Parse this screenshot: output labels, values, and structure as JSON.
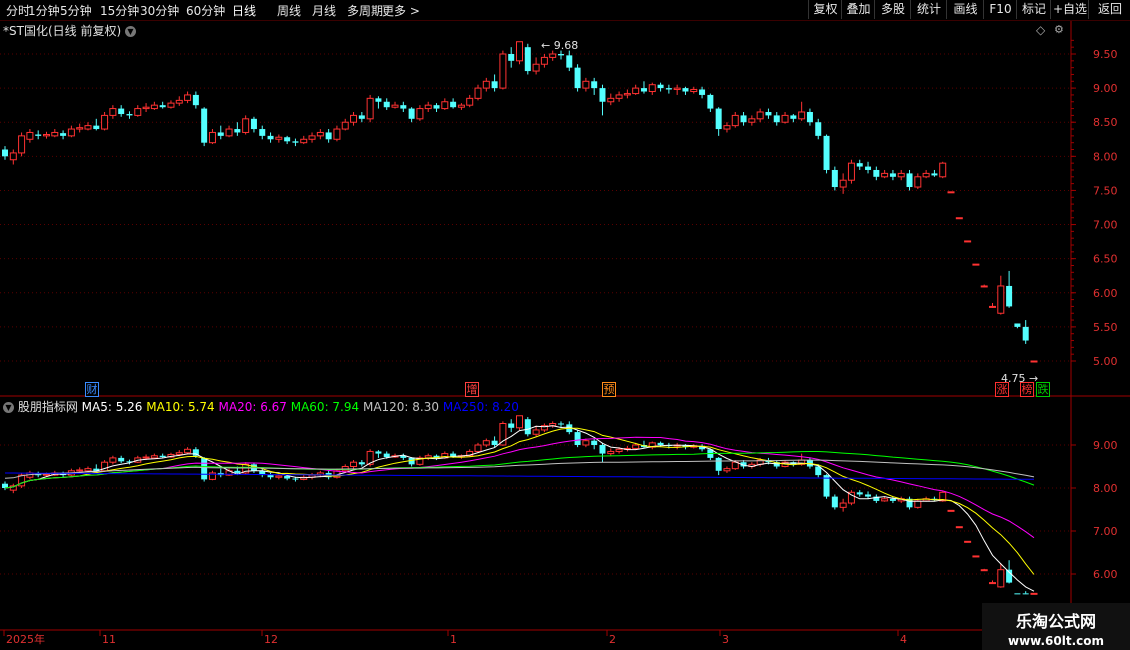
{
  "toolbar": {
    "tabs": [
      "分时",
      "1分钟",
      "5分钟",
      "15分钟",
      "30分钟",
      "60分钟",
      "日线",
      "周线",
      "月线",
      "多周期",
      "更多 >"
    ],
    "active": "日线",
    "right": [
      "复权",
      "叠加",
      "多股",
      "统计",
      "画线",
      "F10",
      "标记",
      "+自选",
      "返回"
    ]
  },
  "title": {
    "text": "*ST国化(日线 前复权)",
    "high_label": "9.68",
    "low_label": "4.75"
  },
  "indicator": {
    "name": "股朋指标网",
    "items": [
      {
        "label": "MA5: 5.26",
        "color": "#ffffff"
      },
      {
        "label": "MA10: 5.74",
        "color": "#ffff00"
      },
      {
        "label": "MA20: 6.67",
        "color": "#ff00ff"
      },
      {
        "label": "MA60: 7.94",
        "color": "#00ff00"
      },
      {
        "label": "MA120: 8.30",
        "color": "#c0c0c0"
      },
      {
        "label": "MA250: 8.20",
        "color": "#0000ff"
      }
    ]
  },
  "markers": [
    {
      "label": "财",
      "color": "#3a8cff"
    },
    {
      "label": "增",
      "color": "#ff4040"
    },
    {
      "label": "预",
      "color": "#ff8c1a"
    },
    {
      "label": "涨",
      "color": "#ff3030"
    },
    {
      "label": "榜",
      "color": "#ff3030"
    },
    {
      "label": "跌",
      "color": "#00cc00"
    }
  ],
  "axis_top": [
    "9.50",
    "9.00",
    "8.50",
    "8.00",
    "7.50",
    "7.00",
    "6.50",
    "6.00",
    "5.50",
    "5.00"
  ],
  "axis_bottom": [
    "9.00",
    "8.00",
    "7.00",
    "6.00"
  ],
  "dates": [
    "2025年",
    "11",
    "12",
    "1",
    "2",
    "3",
    "4"
  ],
  "watermark": {
    "line1": "乐淘公式网",
    "line2": "www.60lt.com"
  },
  "chart_data": {
    "type": "candlestick",
    "ylim_main": [
      4.7,
      10.0
    ],
    "ylim_sub": [
      5.6,
      9.8
    ],
    "candles": [
      [
        8.1,
        8.0,
        8.15,
        7.95
      ],
      [
        7.95,
        8.05,
        8.1,
        7.88
      ],
      [
        8.05,
        8.3,
        8.35,
        8.0
      ],
      [
        8.25,
        8.35,
        8.4,
        8.2
      ],
      [
        8.32,
        8.3,
        8.38,
        8.25
      ],
      [
        8.3,
        8.32,
        8.36,
        8.26
      ],
      [
        8.3,
        8.35,
        8.4,
        8.28
      ],
      [
        8.34,
        8.3,
        8.38,
        8.25
      ],
      [
        8.3,
        8.4,
        8.45,
        8.28
      ],
      [
        8.4,
        8.42,
        8.48,
        8.35
      ],
      [
        8.4,
        8.45,
        8.5,
        8.38
      ],
      [
        8.45,
        8.4,
        8.55,
        8.38
      ],
      [
        8.4,
        8.6,
        8.65,
        8.38
      ],
      [
        8.6,
        8.7,
        8.75,
        8.55
      ],
      [
        8.7,
        8.62,
        8.75,
        8.58
      ],
      [
        8.62,
        8.6,
        8.66,
        8.55
      ],
      [
        8.6,
        8.7,
        8.75,
        8.58
      ],
      [
        8.7,
        8.72,
        8.78,
        8.65
      ],
      [
        8.7,
        8.75,
        8.8,
        8.68
      ],
      [
        8.75,
        8.72,
        8.8,
        8.7
      ],
      [
        8.72,
        8.78,
        8.82,
        8.7
      ],
      [
        8.78,
        8.82,
        8.88,
        8.74
      ],
      [
        8.82,
        8.9,
        8.95,
        8.78
      ],
      [
        8.9,
        8.75,
        8.95,
        8.7
      ],
      [
        8.7,
        8.2,
        8.72,
        8.15
      ],
      [
        8.2,
        8.35,
        8.4,
        8.18
      ],
      [
        8.35,
        8.3,
        8.45,
        8.25
      ],
      [
        8.3,
        8.4,
        8.45,
        8.28
      ],
      [
        8.4,
        8.35,
        8.5,
        8.3
      ],
      [
        8.35,
        8.55,
        8.6,
        8.32
      ],
      [
        8.55,
        8.4,
        8.58,
        8.35
      ],
      [
        8.4,
        8.3,
        8.45,
        8.25
      ],
      [
        8.3,
        8.25,
        8.35,
        8.2
      ],
      [
        8.25,
        8.28,
        8.32,
        8.2
      ],
      [
        8.28,
        8.22,
        8.3,
        8.18
      ],
      [
        8.22,
        8.2,
        8.26,
        8.15
      ],
      [
        8.2,
        8.25,
        8.3,
        8.18
      ],
      [
        8.25,
        8.3,
        8.35,
        8.2
      ],
      [
        8.3,
        8.35,
        8.4,
        8.25
      ],
      [
        8.35,
        8.25,
        8.4,
        8.2
      ],
      [
        8.25,
        8.4,
        8.45,
        8.22
      ],
      [
        8.4,
        8.5,
        8.55,
        8.38
      ],
      [
        8.5,
        8.6,
        8.65,
        8.45
      ],
      [
        8.6,
        8.55,
        8.65,
        8.5
      ],
      [
        8.55,
        8.85,
        8.9,
        8.5
      ],
      [
        8.85,
        8.8,
        8.88,
        8.7
      ],
      [
        8.8,
        8.72,
        8.85,
        8.68
      ],
      [
        8.72,
        8.75,
        8.8,
        8.7
      ],
      [
        8.75,
        8.7,
        8.8,
        8.65
      ],
      [
        8.7,
        8.55,
        8.72,
        8.5
      ],
      [
        8.55,
        8.7,
        8.75,
        8.52
      ],
      [
        8.7,
        8.75,
        8.8,
        8.65
      ],
      [
        8.75,
        8.7,
        8.78,
        8.65
      ],
      [
        8.7,
        8.8,
        8.85,
        8.68
      ],
      [
        8.8,
        8.72,
        8.85,
        8.7
      ],
      [
        8.72,
        8.75,
        8.78,
        8.68
      ],
      [
        8.75,
        8.85,
        8.9,
        8.72
      ],
      [
        8.85,
        9.0,
        9.05,
        8.82
      ],
      [
        9.0,
        9.1,
        9.15,
        8.95
      ],
      [
        9.1,
        9.0,
        9.2,
        8.95
      ],
      [
        9.0,
        9.5,
        9.55,
        8.98
      ],
      [
        9.5,
        9.4,
        9.6,
        9.3
      ],
      [
        9.4,
        9.68,
        9.68,
        9.35
      ],
      [
        9.6,
        9.25,
        9.65,
        9.2
      ],
      [
        9.25,
        9.35,
        9.45,
        9.2
      ],
      [
        9.35,
        9.45,
        9.5,
        9.3
      ],
      [
        9.45,
        9.5,
        9.55,
        9.4
      ],
      [
        9.5,
        9.48,
        9.55,
        9.42
      ],
      [
        9.48,
        9.3,
        9.55,
        9.25
      ],
      [
        9.3,
        9.0,
        9.35,
        8.95
      ],
      [
        9.0,
        9.1,
        9.15,
        8.95
      ],
      [
        9.1,
        9.0,
        9.15,
        8.9
      ],
      [
        9.0,
        8.8,
        9.05,
        8.6
      ],
      [
        8.8,
        8.85,
        8.92,
        8.75
      ],
      [
        8.85,
        8.9,
        8.95,
        8.8
      ],
      [
        8.9,
        8.92,
        8.98,
        8.85
      ],
      [
        8.92,
        9.0,
        9.05,
        8.9
      ],
      [
        9.0,
        8.95,
        9.1,
        8.92
      ],
      [
        8.95,
        9.05,
        9.08,
        8.9
      ],
      [
        9.05,
        9.0,
        9.08,
        8.95
      ],
      [
        9.0,
        8.98,
        9.05,
        8.92
      ],
      [
        8.98,
        9.0,
        9.05,
        8.9
      ],
      [
        9.0,
        8.95,
        9.02,
        8.9
      ],
      [
        8.95,
        8.98,
        9.02,
        8.92
      ],
      [
        8.98,
        8.9,
        9.02,
        8.85
      ],
      [
        8.9,
        8.7,
        8.92,
        8.65
      ],
      [
        8.7,
        8.4,
        8.72,
        8.3
      ],
      [
        8.4,
        8.45,
        8.5,
        8.35
      ],
      [
        8.45,
        8.6,
        8.65,
        8.42
      ],
      [
        8.6,
        8.5,
        8.65,
        8.45
      ],
      [
        8.5,
        8.55,
        8.6,
        8.45
      ],
      [
        8.55,
        8.65,
        8.7,
        8.5
      ],
      [
        8.65,
        8.6,
        8.7,
        8.55
      ],
      [
        8.6,
        8.5,
        8.65,
        8.45
      ],
      [
        8.5,
        8.6,
        8.65,
        8.48
      ],
      [
        8.6,
        8.55,
        8.62,
        8.5
      ],
      [
        8.55,
        8.65,
        8.8,
        8.52
      ],
      [
        8.65,
        8.5,
        8.7,
        8.45
      ],
      [
        8.5,
        8.3,
        8.55,
        8.25
      ],
      [
        8.3,
        7.8,
        8.32,
        7.75
      ],
      [
        7.8,
        7.55,
        7.85,
        7.5
      ],
      [
        7.55,
        7.65,
        7.75,
        7.45
      ],
      [
        7.65,
        7.9,
        7.95,
        7.6
      ],
      [
        7.9,
        7.85,
        7.95,
        7.8
      ],
      [
        7.85,
        7.8,
        7.92,
        7.75
      ],
      [
        7.8,
        7.7,
        7.85,
        7.65
      ],
      [
        7.7,
        7.75,
        7.8,
        7.68
      ],
      [
        7.75,
        7.7,
        7.8,
        7.65
      ],
      [
        7.7,
        7.75,
        7.8,
        7.65
      ],
      [
        7.75,
        7.55,
        7.8,
        7.5
      ],
      [
        7.55,
        7.7,
        7.75,
        7.52
      ],
      [
        7.7,
        7.75,
        7.8,
        7.68
      ],
      [
        7.75,
        7.72,
        7.8,
        7.7
      ],
      [
        7.7,
        7.9,
        7.92,
        7.68
      ],
      [
        7.48,
        7.48,
        7.48,
        7.48
      ],
      [
        7.1,
        7.1,
        7.1,
        7.1
      ],
      [
        6.76,
        6.76,
        6.76,
        6.76
      ],
      [
        6.42,
        6.42,
        6.42,
        6.42
      ],
      [
        6.1,
        6.1,
        6.12,
        6.08
      ],
      [
        5.8,
        5.8,
        5.85,
        5.78
      ],
      [
        5.7,
        6.1,
        6.25,
        5.68
      ],
      [
        6.1,
        5.8,
        6.32,
        5.78
      ],
      [
        5.55,
        5.5,
        5.55,
        5.48
      ],
      [
        5.5,
        5.3,
        5.6,
        5.25
      ],
      [
        5.0,
        5.0,
        5.0,
        5.0
      ]
    ]
  }
}
